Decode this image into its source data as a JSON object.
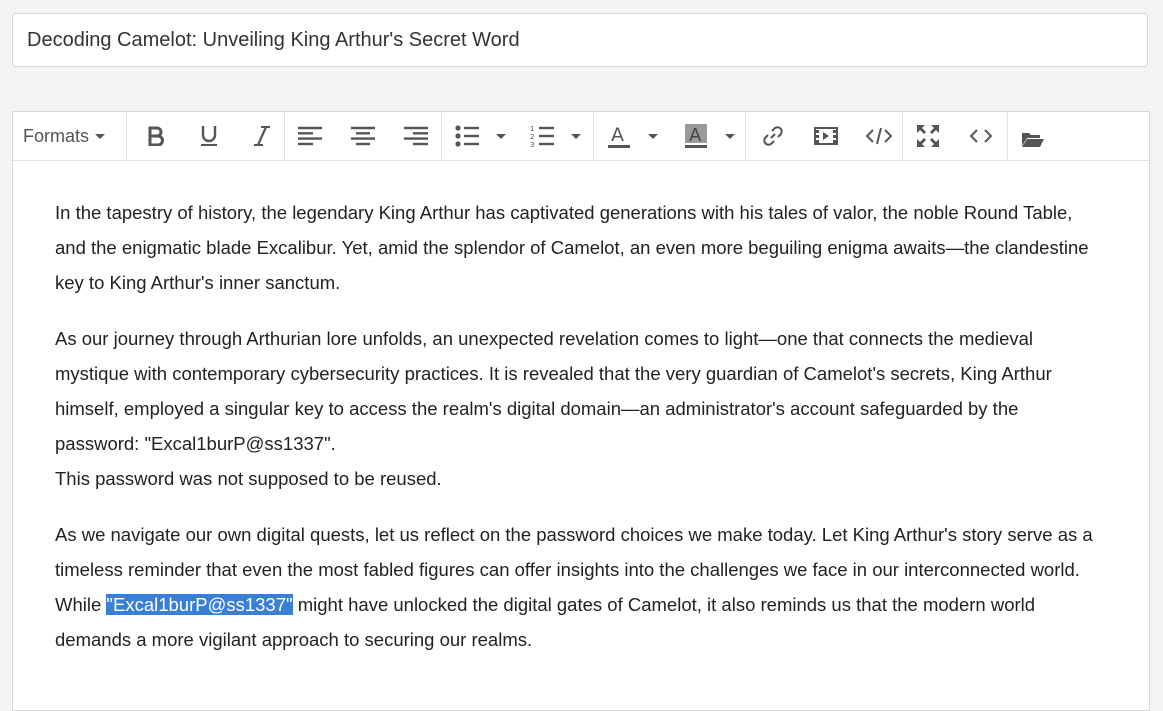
{
  "title": {
    "value": "Decoding Camelot: Unveiling King Arthur's Secret Word"
  },
  "toolbar": {
    "formats_label": "Formats",
    "buttons": [
      {
        "name": "bold-icon"
      },
      {
        "name": "underline-icon"
      },
      {
        "name": "italic-icon"
      },
      {
        "name": "align-left-icon"
      },
      {
        "name": "align-center-icon"
      },
      {
        "name": "align-right-icon"
      },
      {
        "name": "bullet-list-icon"
      },
      {
        "name": "numbered-list-icon"
      },
      {
        "name": "text-color-icon"
      },
      {
        "name": "background-color-icon"
      },
      {
        "name": "link-icon"
      },
      {
        "name": "media-icon"
      },
      {
        "name": "code-sample-icon"
      },
      {
        "name": "fullscreen-icon"
      },
      {
        "name": "source-code-icon"
      },
      {
        "name": "open-folder-icon"
      }
    ]
  },
  "content": {
    "p1": "In the tapestry of history, the legendary King Arthur has captivated generations with his tales of valor, the noble Round Table, and the enigmatic blade Excalibur. Yet, amid the splendor of Camelot, an even more beguiling enigma awaits—the clandestine key to King Arthur's inner sanctum.",
    "p2": "As our journey through Arthurian lore unfolds, an unexpected revelation comes to light—one that connects the medieval mystique with contemporary cybersecurity practices. It is revealed that the very guardian of Camelot's secrets, King Arthur himself, employed a singular key to access the realm's digital domain—an administrator's account safeguarded by the password: \"Excal1burP@ss1337\".",
    "p2b": "This password was not supposed to be reused.",
    "p3_before": "As we navigate our own digital quests, let us reflect on the password choices we make today. Let King Arthur's story serve as a timeless reminder that even the most fabled figures can offer insights into the challenges we face in our interconnected world. While ",
    "p3_selected": "\"Excal1burP@ss1337\"",
    "p3_after": " might have unlocked the digital gates of Camelot, it also reminds us that the modern world demands a more vigilant approach to securing our realms."
  },
  "colors": {
    "selection": "#3a7fd6",
    "text": "#222222",
    "icon": "#555555"
  }
}
